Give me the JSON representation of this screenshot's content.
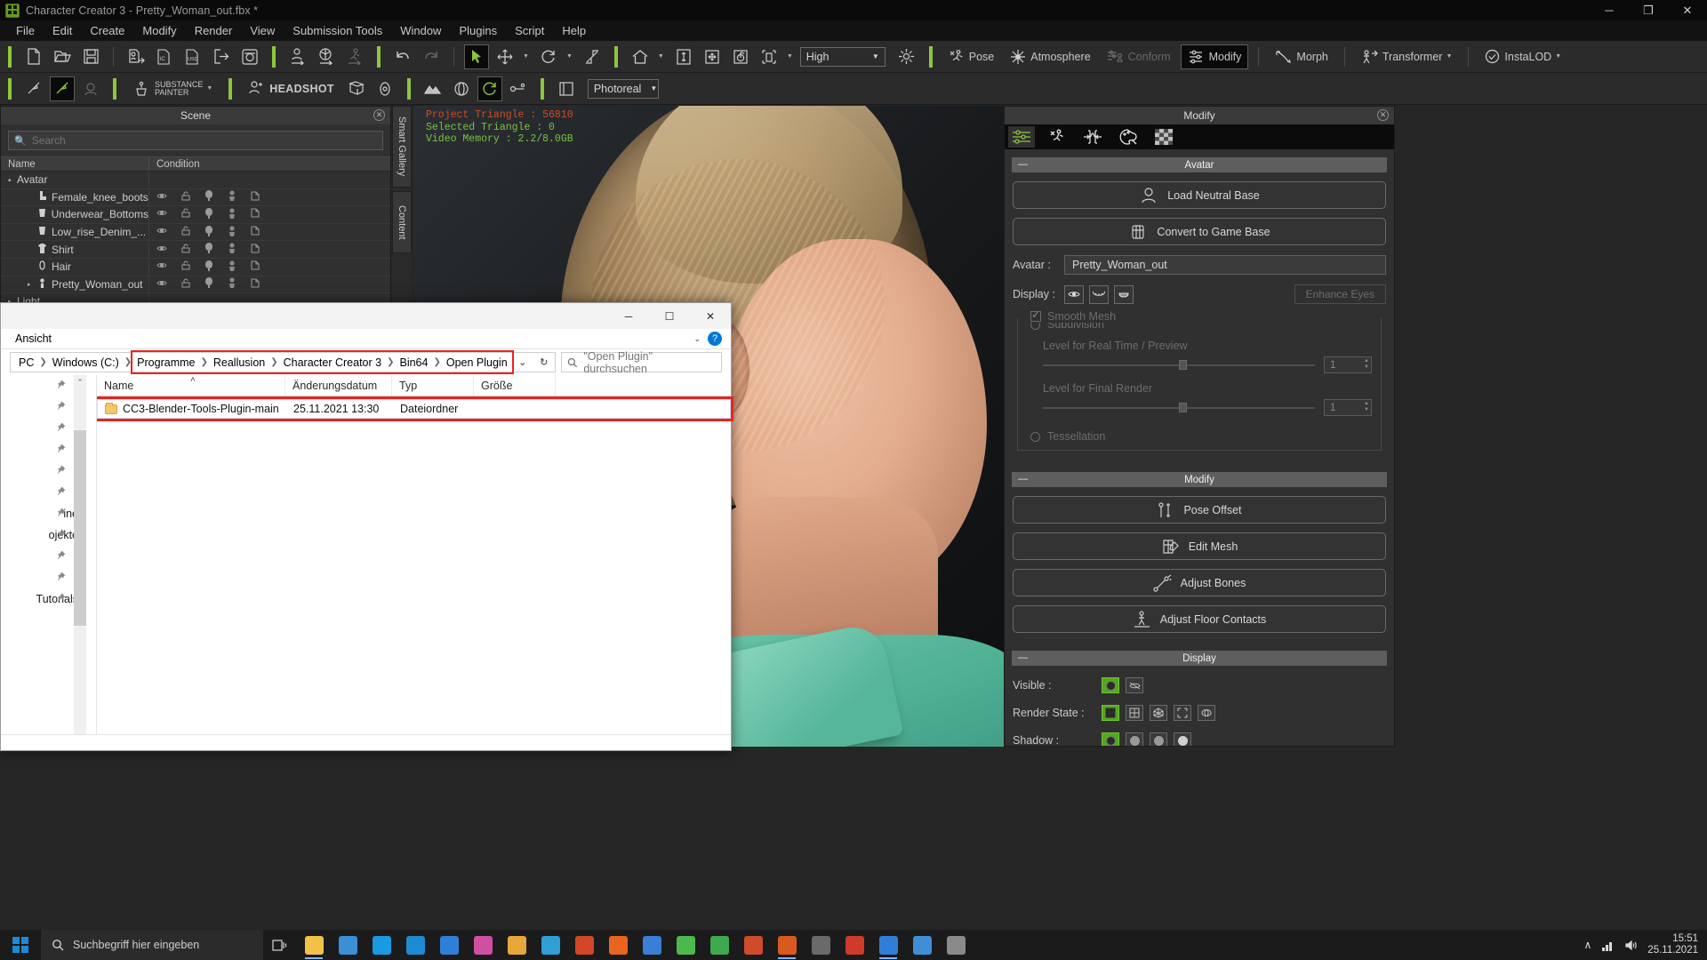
{
  "window": {
    "title": "Character Creator 3 - Pretty_Woman_out.fbx *",
    "app_icon": "cc3-app-icon",
    "minimize": "─",
    "maximize": "❐",
    "close": "✕"
  },
  "menubar": {
    "items": [
      "File",
      "Edit",
      "Create",
      "Modify",
      "Render",
      "View",
      "Submission Tools",
      "Window",
      "Plugins",
      "Script",
      "Help"
    ]
  },
  "toolbar1": {
    "quality_value": "High",
    "pose_label": "Pose",
    "atmosphere_label": "Atmosphere",
    "conform_label": "Conform",
    "modify_label": "Modify",
    "morph_label": "Morph",
    "transformer_label": "Transformer",
    "instalod_label": "InstaLOD"
  },
  "toolbar2": {
    "substance_label_1": "SUBSTANCE",
    "substance_label_2": "PAINTER",
    "headshot_label": "HEADSHOT",
    "render_mode_value": "Photoreal"
  },
  "scene_panel": {
    "title": "Scene",
    "search_placeholder": "Search",
    "search_value": "",
    "columns": [
      "Name",
      "Condition"
    ],
    "rows": [
      {
        "name": "Avatar",
        "indent": 0,
        "expander": "▴",
        "icon": "",
        "has_condition": false
      },
      {
        "name": "Female_knee_boots",
        "indent": 1,
        "expander": "",
        "icon": "boot-icon",
        "has_condition": true
      },
      {
        "name": "Underwear_Bottoms",
        "indent": 1,
        "expander": "",
        "icon": "cloth-icon",
        "has_condition": true
      },
      {
        "name": "Low_rise_Denim_...",
        "indent": 1,
        "expander": "",
        "icon": "cloth-icon",
        "has_condition": true
      },
      {
        "name": "Shirt",
        "indent": 1,
        "expander": "",
        "icon": "shirt-icon",
        "has_condition": true
      },
      {
        "name": "Hair",
        "indent": 1,
        "expander": "",
        "icon": "hair-icon",
        "has_condition": true
      },
      {
        "name": "Pretty_Woman_out",
        "indent": 1,
        "expander": "▸",
        "icon": "avatar-icon",
        "has_condition": true
      },
      {
        "name": "Light",
        "indent": 0,
        "expander": "▸",
        "icon": "",
        "has_condition": false
      }
    ]
  },
  "vertical_tabs": [
    "Smart Gallery",
    "Content"
  ],
  "viewport": {
    "stat_project_triangle": "Project Triangle :  56810",
    "stat_selected_triangle": "Selected Triangle :  0",
    "stat_video_memory": "Video Memory :  2.2/8.0GB"
  },
  "modify_panel": {
    "title": "Modify",
    "tabs": [
      "modify-sliders-icon",
      "pose-icon",
      "body-icon",
      "material-icon",
      "texture-icon"
    ],
    "avatar_group": "Avatar",
    "load_neutral_base": "Load Neutral Base",
    "convert_to_game_base": "Convert to Game Base",
    "avatar_label": "Avatar :",
    "avatar_value": "Pretty_Woman_out",
    "display_label": "Display :",
    "enhance_eyes": "Enhance Eyes",
    "smooth_mesh": "Smooth Mesh",
    "subdivision": "Subdivision",
    "level_realtime": "Level for Real Time / Preview",
    "level_realtime_value": "1",
    "level_final": "Level for Final Render",
    "level_final_value": "1",
    "tessellation": "Tessellation",
    "modify_group": "Modify",
    "pose_offset": "Pose Offset",
    "edit_mesh": "Edit Mesh",
    "adjust_bones": "Adjust Bones",
    "adjust_floor_contacts": "Adjust Floor Contacts",
    "display_group": "Display",
    "visible_label": "Visible :",
    "render_state_label": "Render State :",
    "shadow_label": "Shadow :"
  },
  "explorer": {
    "window_controls": {
      "minimize": "─",
      "maximize": "☐",
      "close": "✕"
    },
    "ribbon_tab": "Ansicht",
    "help_icon": "?",
    "breadcrumb_prefix": [
      "PC",
      "Windows (C:)"
    ],
    "breadcrumb": [
      "Programme",
      "Reallusion",
      "Character Creator 3",
      "Bin64",
      "Open Plugin"
    ],
    "dropdown_icon": "⌄",
    "refresh_icon": "↻",
    "search_icon": "search-icon",
    "search_placeholder": "\"Open Plugin\" durchsuchen",
    "nav_items": [
      "",
      "",
      "",
      "",
      "",
      "",
      "ine",
      "ojekte",
      "",
      "",
      "Tutorials"
    ],
    "columns": [
      "Name",
      "Änderungsdatum",
      "Typ",
      "Größe"
    ],
    "sort_indicator": "˄",
    "files": [
      {
        "name": "CC3-Blender-Tools-Plugin-main",
        "modified": "25.11.2021 13:30",
        "type": "Dateiordner",
        "size": ""
      }
    ]
  },
  "taskbar": {
    "start_icon": "windows-start-icon",
    "search_placeholder": "Suchbegriff hier eingeben",
    "task_view_icon": "task-view-icon",
    "apps": [
      {
        "name": "file-explorer-icon",
        "color": "#f2c14a",
        "active": true
      },
      {
        "name": "microsoft-edge-icon",
        "color": "#3b8fd4",
        "active": false
      },
      {
        "name": "skype-icon",
        "color": "#1a9ae0",
        "active": false
      },
      {
        "name": "teamviewer-icon",
        "color": "#1d8ad2",
        "active": false
      },
      {
        "name": "messenger-icon",
        "color": "#2f7fd8",
        "active": false
      },
      {
        "name": "photoshop-icon",
        "color": "#cf4fa0",
        "active": false
      },
      {
        "name": "folder-icon",
        "color": "#e8a73a",
        "active": false
      },
      {
        "name": "blender-icon",
        "color": "#2f9fd6",
        "active": false
      },
      {
        "name": "powerpoint-icon",
        "color": "#d24726",
        "active": false
      },
      {
        "name": "firefox-icon",
        "color": "#e8651f",
        "active": false
      },
      {
        "name": "affinity-icon",
        "color": "#3a7fd5",
        "active": false
      },
      {
        "name": "xsplit-icon",
        "color": "#4eb84e",
        "active": false
      },
      {
        "name": "chrome-icon",
        "color": "#3fa94f",
        "active": false
      },
      {
        "name": "substance-icon",
        "color": "#d04a2c",
        "active": false
      },
      {
        "name": "character-creator-icon",
        "color": "#d85a20",
        "active": true
      },
      {
        "name": "reallusion-icon",
        "color": "#6a6a6a",
        "active": false
      },
      {
        "name": "iclone-icon",
        "color": "#d03a2a",
        "active": false
      },
      {
        "name": "media-player-icon",
        "color": "#2f7fd8",
        "active": true
      },
      {
        "name": "store-icon",
        "color": "#3f8fd8",
        "active": false
      },
      {
        "name": "settings-icon",
        "color": "#8a8a8a",
        "active": false
      }
    ],
    "tray": {
      "chevron": "∧",
      "network_icon": "network-icon",
      "volume_icon": "volume-icon",
      "time": "15:51",
      "date": "25.11.2021"
    }
  }
}
